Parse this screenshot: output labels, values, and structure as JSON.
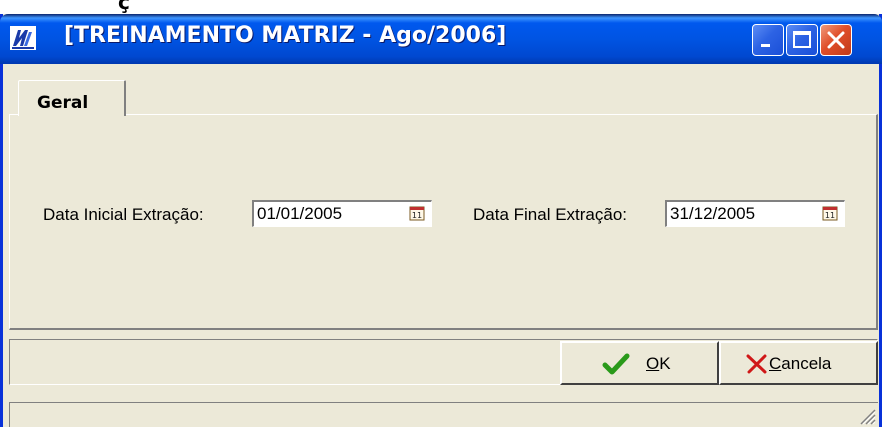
{
  "window": {
    "title": "[TREINAMENTO MATRIZ - Ago/2006]"
  },
  "top_fragment": "ç",
  "tabs": [
    {
      "label": "Geral",
      "active": true
    }
  ],
  "form": {
    "start_label": "Data Inicial Extração:",
    "start_value": "01/01/2005",
    "end_label": "Data Final Extração:",
    "end_value": "31/12/2005"
  },
  "buttons": {
    "ok": {
      "mnemonic": "O",
      "rest": "K"
    },
    "cancel": {
      "mnemonic": "C",
      "rest": "ancela"
    }
  },
  "icons": {
    "app": "app-logo-icon",
    "minimize": "minimize-icon",
    "maximize": "maximize-icon",
    "close": "close-icon",
    "calendar": "calendar-icon",
    "ok": "checkmark-icon",
    "cancel": "x-icon",
    "grip": "resize-grip-icon"
  },
  "colors": {
    "titlebar": "#0054e3",
    "face": "#ece9d8",
    "close_button": "#e04f2b",
    "ok_check": "#2a9a1a",
    "cancel_x": "#d01818"
  }
}
